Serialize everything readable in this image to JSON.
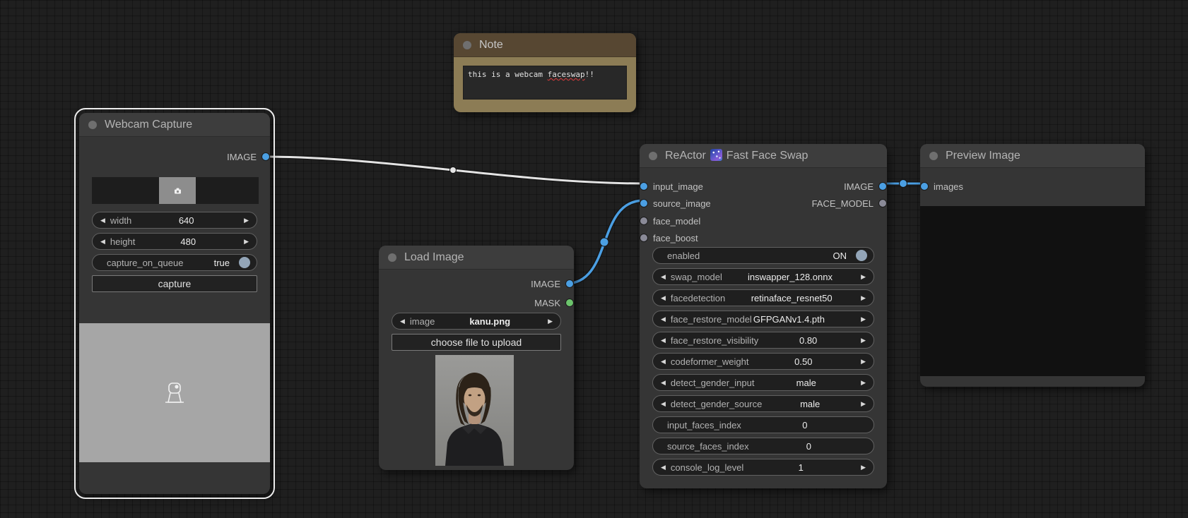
{
  "colors": {
    "canvas_bg": "#1f1f1f",
    "node_bg": "#353535",
    "node_header_bg": "#3d3d3d",
    "note_header_bg": "#574732",
    "note_body_bg": "#8c7c55",
    "accent_blue": "#4b9fe3",
    "accent_green": "#6cc46c",
    "socket_gray": "#8a8a97",
    "wire_white": "#e4e4e4",
    "toggle_circle": "#93a5b8",
    "spellcheck_red": "#e03c3c",
    "webcam_preview_gray": "#a6a6a6"
  },
  "icons": {
    "arrow_left": "◀",
    "arrow_right": "▶",
    "title_dot": "node-collapse-dot",
    "milky_way": "milky-way-emoji",
    "webcam": "webcam-icon",
    "camera_small": "camera-icon"
  },
  "note": {
    "title": "Note",
    "text_prefix": "this is a webcam ",
    "text_flagged": "faceswap",
    "text_suffix": "!!"
  },
  "webcam": {
    "title": "Webcam Capture",
    "outputs": [
      {
        "label": "IMAGE"
      }
    ],
    "widgets": [
      {
        "label": "width",
        "value": "640",
        "type": "number"
      },
      {
        "label": "height",
        "value": "480",
        "type": "number"
      },
      {
        "label": "capture_on_queue",
        "value": "true",
        "type": "toggle"
      },
      {
        "label": "capture",
        "type": "button"
      }
    ]
  },
  "load_image": {
    "title": "Load Image",
    "outputs": [
      {
        "label": "IMAGE"
      },
      {
        "label": "MASK"
      }
    ],
    "widgets": [
      {
        "label": "image",
        "value": "kanu.png",
        "type": "combo"
      },
      {
        "label": "choose file to upload",
        "type": "button"
      }
    ]
  },
  "reactor": {
    "title": "ReActor",
    "title_suffix": "Fast Face Swap",
    "inputs": [
      {
        "label": "input_image"
      },
      {
        "label": "source_image"
      },
      {
        "label": "face_model"
      },
      {
        "label": "face_boost"
      }
    ],
    "outputs": [
      {
        "label": "IMAGE"
      },
      {
        "label": "FACE_MODEL"
      }
    ],
    "widgets": [
      {
        "label": "enabled",
        "value": "ON",
        "type": "toggle"
      },
      {
        "label": "swap_model",
        "value": "inswapper_128.onnx",
        "type": "combo"
      },
      {
        "label": "facedetection",
        "value": "retinaface_resnet50",
        "type": "combo"
      },
      {
        "label": "face_restore_model",
        "value": "GFPGANv1.4.pth",
        "type": "combo"
      },
      {
        "label": "face_restore_visibility",
        "value": "0.80",
        "type": "number"
      },
      {
        "label": "codeformer_weight",
        "value": "0.50",
        "type": "number"
      },
      {
        "label": "detect_gender_input",
        "value": "male",
        "type": "combo"
      },
      {
        "label": "detect_gender_source",
        "value": "male",
        "type": "combo"
      },
      {
        "label": "input_faces_index",
        "value": "0",
        "type": "text"
      },
      {
        "label": "source_faces_index",
        "value": "0",
        "type": "text"
      },
      {
        "label": "console_log_level",
        "value": "1",
        "type": "number"
      }
    ]
  },
  "preview": {
    "title": "Preview Image",
    "inputs": [
      {
        "label": "images"
      }
    ]
  }
}
